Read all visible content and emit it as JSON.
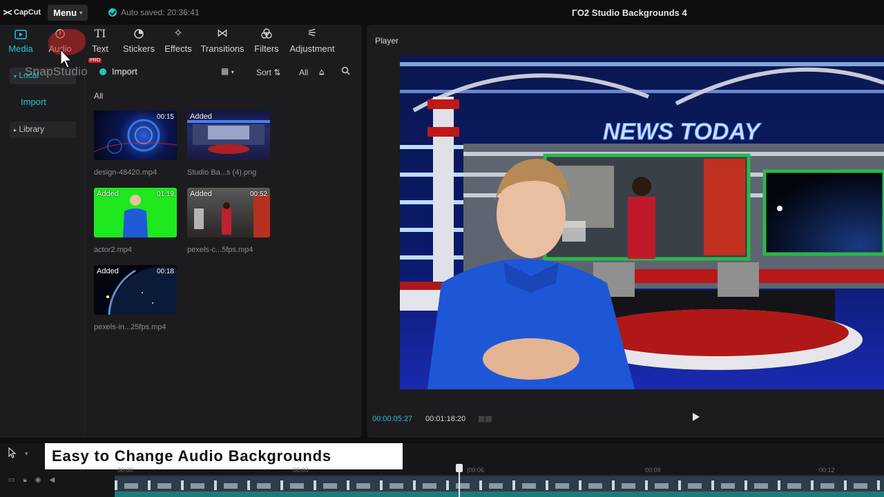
{
  "app": {
    "logo_text": "CapCut",
    "menu_label": "Menu",
    "autosave_text": "Auto saved: 20:36:41",
    "project_title": "ΓΟ2 Studio Backgrounds 4"
  },
  "tabs": [
    {
      "label": "Media",
      "icon": "media-icon",
      "active": true
    },
    {
      "label": "Audio",
      "icon": "audio-icon",
      "active": false
    },
    {
      "label": "Text",
      "icon": "text-icon",
      "active": false
    },
    {
      "label": "Stickers",
      "icon": "stickers-icon",
      "active": false
    },
    {
      "label": "Effects",
      "icon": "effects-icon",
      "active": false
    },
    {
      "label": "Transitions",
      "icon": "transitions-icon",
      "active": false
    },
    {
      "label": "Filters",
      "icon": "filters-icon",
      "active": false
    },
    {
      "label": "Adjustment",
      "icon": "adjustment-icon",
      "active": false
    }
  ],
  "sidebar": {
    "local_label": "Local",
    "import_label": "Import",
    "library_label": "Library"
  },
  "watermark": {
    "text": "SnapStudio",
    "pro_badge": "PRO"
  },
  "toolbar": {
    "import_label": "Import",
    "sort_label": "Sort",
    "all_label": "All"
  },
  "filter_label": "All",
  "media": [
    {
      "name": "design-48420.mp4",
      "duration": "00:15",
      "added": false,
      "thumb": "blue-tech"
    },
    {
      "name": "Studio Ba...s (4).png",
      "duration": "",
      "added": true,
      "badge": "Added",
      "thumb": "studio"
    },
    {
      "name": "actor2.mp4",
      "duration": "01:19",
      "added": true,
      "badge": "Added",
      "thumb": "greenscreen"
    },
    {
      "name": "pexels-c...5fps.mp4",
      "duration": "00:52",
      "added": true,
      "badge": "Added",
      "thumb": "street"
    },
    {
      "name": "pexels-in...25fps.mp4",
      "duration": "00:18",
      "added": true,
      "badge": "Added",
      "thumb": "earth"
    }
  ],
  "player": {
    "title": "Player",
    "current_time": "00:00:05:27",
    "total_time": "00:01:18:20",
    "scene_banner": "NEWS TODAY"
  },
  "timeline": {
    "caption": "Easy to Change Audio Backgrounds",
    "ruler": [
      "00:00",
      "00:03",
      "|00:06",
      "00:09",
      "00:12"
    ]
  },
  "colors": {
    "accent": "#22c4d6",
    "panel": "#1c1c1e",
    "background": "#0f0f10"
  }
}
